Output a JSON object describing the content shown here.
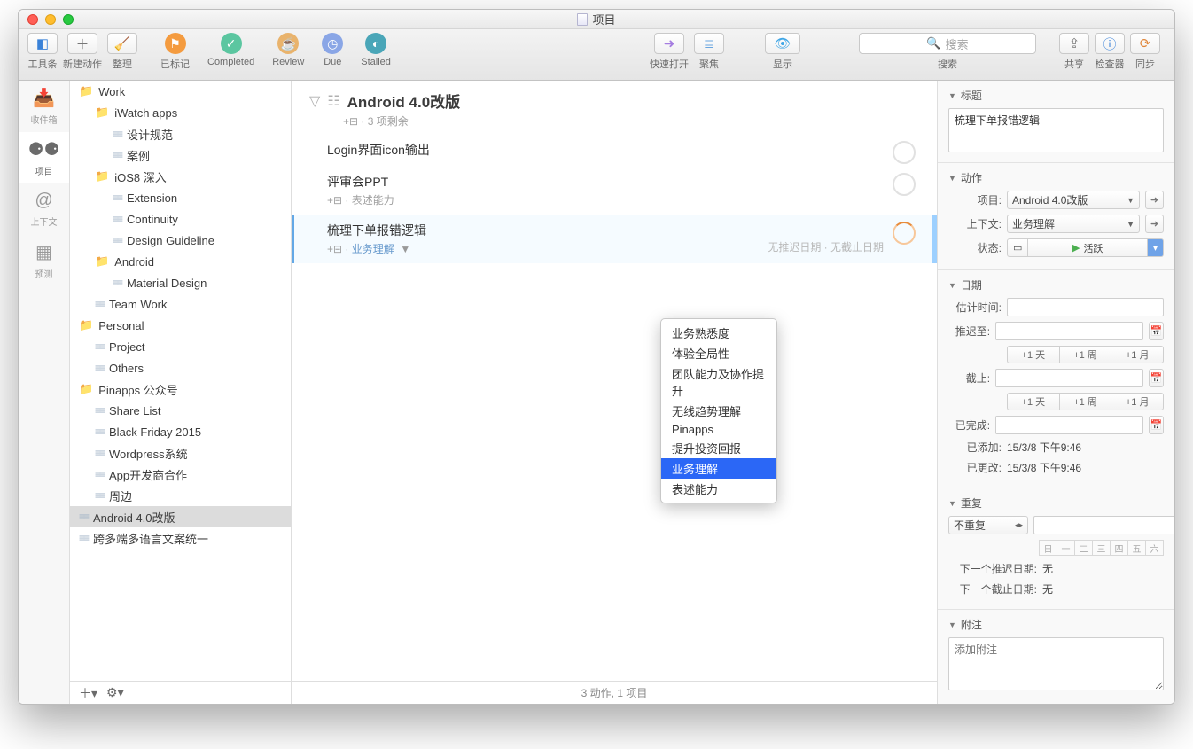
{
  "window_title": "项目",
  "toolbar": {
    "left": [
      {
        "label": "工具条",
        "icon": "◧"
      },
      {
        "label": "新建动作",
        "icon": "＋"
      },
      {
        "label": "整理",
        "icon": "🧹"
      }
    ],
    "perspectives": [
      {
        "label": "已标记",
        "color": "#f49b3f",
        "glyph": "⚑"
      },
      {
        "label": "Completed",
        "color": "#5bc6a0",
        "glyph": "✓"
      },
      {
        "label": "Review",
        "color": "#e9b36c",
        "glyph": "☕"
      },
      {
        "label": "Due",
        "color": "#8aa6e6",
        "glyph": "◷"
      },
      {
        "label": "Stalled",
        "color": "#4aa6b8",
        "glyph": "◐"
      }
    ],
    "mid": [
      {
        "label": "快速打开",
        "icon": "➜"
      },
      {
        "label": "聚焦",
        "icon": "≣"
      }
    ],
    "view": {
      "label": "显示",
      "icon": "👁"
    },
    "search": {
      "label": "搜索",
      "placeholder": "搜索"
    },
    "right": [
      {
        "label": "共享",
        "icon": "⇪"
      },
      {
        "label": "检查器",
        "icon": "ⓘ"
      },
      {
        "label": "同步",
        "icon": "⟳"
      }
    ]
  },
  "rail": [
    {
      "label": "收件箱",
      "icon": "📥"
    },
    {
      "label": "项目",
      "icon": "⚈⚈",
      "active": true
    },
    {
      "label": "上下文",
      "icon": "@"
    },
    {
      "label": "预测",
      "icon": "▦"
    }
  ],
  "sidebar": [
    {
      "t": "folder",
      "l": "Work",
      "d": 0
    },
    {
      "t": "folder",
      "l": "iWatch apps",
      "d": 1
    },
    {
      "t": "proj",
      "l": "设计规范",
      "d": 2
    },
    {
      "t": "proj",
      "l": "案例",
      "d": 2
    },
    {
      "t": "folder",
      "l": "iOS8 深入",
      "d": 1
    },
    {
      "t": "proj",
      "l": "Extension",
      "d": 2
    },
    {
      "t": "proj",
      "l": "Continuity",
      "d": 2
    },
    {
      "t": "proj",
      "l": "Design Guideline",
      "d": 2
    },
    {
      "t": "folder",
      "l": "Android",
      "d": 1
    },
    {
      "t": "proj",
      "l": "Material Design",
      "d": 2
    },
    {
      "t": "proj",
      "l": "Team Work",
      "d": 1
    },
    {
      "t": "folder",
      "l": "Personal",
      "d": 0
    },
    {
      "t": "proj",
      "l": "Project",
      "d": 1
    },
    {
      "t": "proj",
      "l": "Others",
      "d": 1
    },
    {
      "t": "folder",
      "l": "Pinapps 公众号",
      "d": 0
    },
    {
      "t": "proj",
      "l": "Share List",
      "d": 1
    },
    {
      "t": "proj",
      "l": "Black Friday 2015",
      "d": 1
    },
    {
      "t": "proj",
      "l": "Wordpress系统",
      "d": 1
    },
    {
      "t": "proj",
      "l": "App开发商合作",
      "d": 1
    },
    {
      "t": "proj",
      "l": "周边",
      "d": 1
    },
    {
      "t": "proj",
      "l": "Android 4.0改版",
      "d": 0,
      "sel": true
    },
    {
      "t": "proj",
      "l": "跨多端多语言文案统一",
      "d": 0
    }
  ],
  "main": {
    "title": "Android 4.0改版",
    "subtitle": "+⊟ · 3 项剩余",
    "tasks": [
      {
        "title": "Login界面icon输出",
        "meta": ""
      },
      {
        "title": "评审会PPT",
        "meta": "+⊟ · 表述能力"
      },
      {
        "title": "梳理下单报错逻辑",
        "meta_prefix": "+⊟ · ",
        "context": "业务理解",
        "dates": "无推迟日期 · 无截止日期",
        "sel": true
      }
    ],
    "footer": "3 动作, 1 项目"
  },
  "dropdown": {
    "items": [
      "业务熟悉度",
      "体验全局性",
      "团队能力及协作提升",
      "无线趋势理解",
      "Pinapps",
      "提升投资回报",
      "业务理解",
      "表述能力"
    ],
    "selected": "业务理解"
  },
  "inspector": {
    "title_sec": "标题",
    "title_value": "梳理下单报错逻辑",
    "action_sec": "动作",
    "project_label": "项目:",
    "project_value": "Android 4.0改版",
    "context_label": "上下文:",
    "context_value": "业务理解",
    "status_label": "状态:",
    "status_value": "活跃",
    "dates_sec": "日期",
    "est_label": "估计时间:",
    "defer_label": "推迟至:",
    "due_label": "截止:",
    "seg_day": "+1 天",
    "seg_week": "+1 周",
    "seg_month": "+1 月",
    "done_label": "已完成:",
    "added_label": "已添加:",
    "added_value": "15/3/8 下午9:46",
    "changed_label": "已更改:",
    "changed_value": "15/3/8 下午9:46",
    "repeat_sec": "重复",
    "repeat_value": "不重复",
    "days": [
      "日",
      "一",
      "二",
      "三",
      "四",
      "五",
      "六"
    ],
    "next_defer_label": "下一个推迟日期:",
    "next_defer_value": "无",
    "next_due_label": "下一个截止日期:",
    "next_due_value": "无",
    "note_sec": "附注",
    "note_placeholder": "添加附注"
  }
}
